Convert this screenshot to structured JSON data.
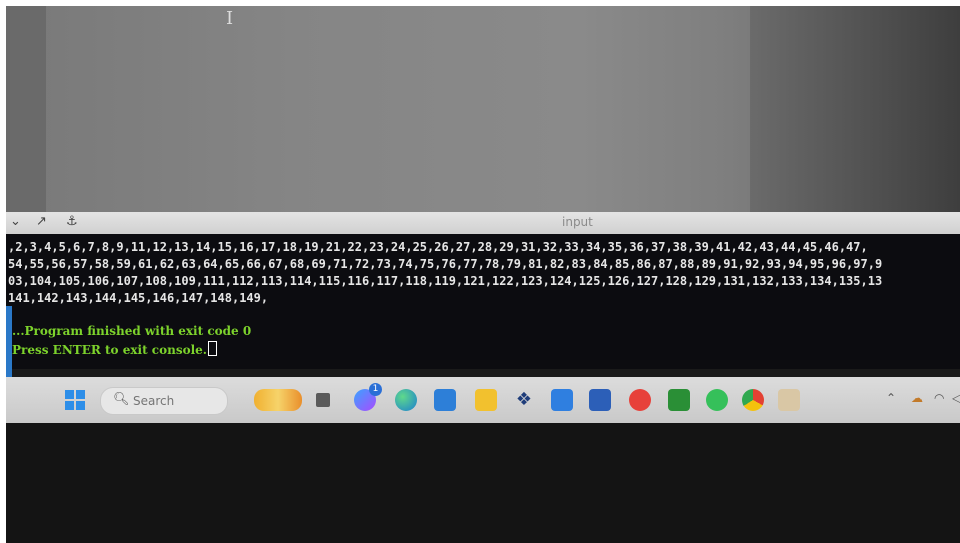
{
  "console_bar": {
    "title": "input",
    "icons": [
      "chevron-down-icon",
      "expand-icon",
      "pin-icon"
    ]
  },
  "console": {
    "output_lines": [
      ",2,3,4,5,6,7,8,9,11,12,13,14,15,16,17,18,19,21,22,23,24,25,26,27,28,29,31,32,33,34,35,36,37,38,39,41,42,43,44,45,46,47,",
      "54,55,56,57,58,59,61,62,63,64,65,66,67,68,69,71,72,73,74,75,76,77,78,79,81,82,83,84,85,86,87,88,89,91,92,93,94,95,96,97,9",
      "03,104,105,106,107,108,109,111,112,113,114,115,116,117,118,119,121,122,123,124,125,126,127,128,129,131,132,133,134,135,13",
      "141,142,143,144,145,146,147,148,149,"
    ],
    "exit_message": "...Program finished with exit code 0",
    "prompt_message": "Press ENTER to exit console."
  },
  "taskbar": {
    "search_placeholder": "Search",
    "icons": [
      "windows-start-icon",
      "search-icon",
      "widgets-icon",
      "task-view-icon",
      "copilot-icon",
      "edge-icon",
      "store-icon",
      "file-explorer-icon",
      "dropbox-icon",
      "app-icon",
      "dolby-icon",
      "chrome-remote-icon",
      "nvidia-icon",
      "whatsapp-icon",
      "chrome-icon",
      "photo-app-icon"
    ],
    "notification_badge": "1"
  },
  "tray": {
    "icons": [
      "chevron-up-icon",
      "cloud-icon",
      "wifi-icon",
      "speaker-icon"
    ]
  },
  "colors": {
    "console_bg": "#0c0c10",
    "console_text": "#e6e6e6",
    "status_text": "#7dd32c",
    "taskbar_bg": "#d4d4d4"
  }
}
